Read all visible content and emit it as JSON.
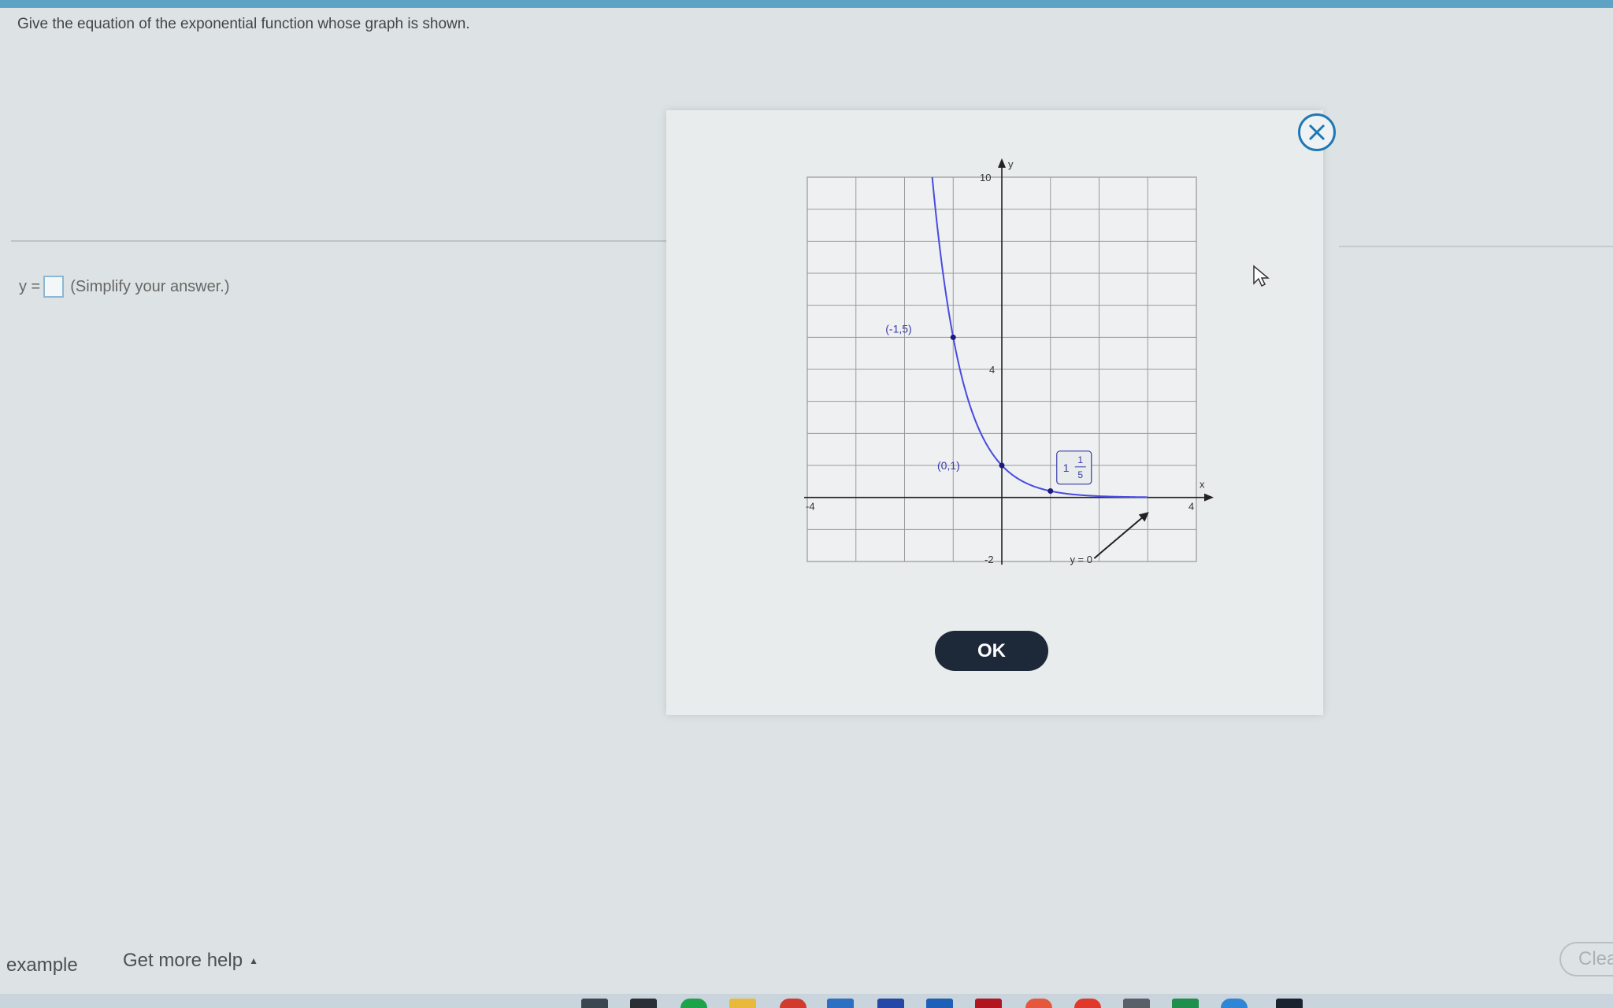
{
  "question": {
    "text": "Give the equation of the exponential function whose graph is shown."
  },
  "answer": {
    "prefix": "y =",
    "hint": "(Simplify your answer.)"
  },
  "graph": {
    "x_axis_label": "x",
    "y_axis_label": "y",
    "tick_labels": {
      "x_min": "-4",
      "x_max": "4",
      "y_max": "10",
      "y_mid": "4",
      "y_min": "-2"
    },
    "points": [
      {
        "label": "(-1,5)",
        "x": -1,
        "y": 5
      },
      {
        "label": "(0,1)",
        "x": 0,
        "y": 1
      },
      {
        "label_whole": "1",
        "label_num": "1",
        "label_den": "5",
        "x": 1,
        "y": 0.2
      }
    ],
    "asymptote_label": "y = 0",
    "curve_color": "#4a4ae0"
  },
  "modal": {
    "ok_label": "OK"
  },
  "footer": {
    "example_label": "example",
    "help_label": "Get more help",
    "clear_label": "Clea"
  }
}
